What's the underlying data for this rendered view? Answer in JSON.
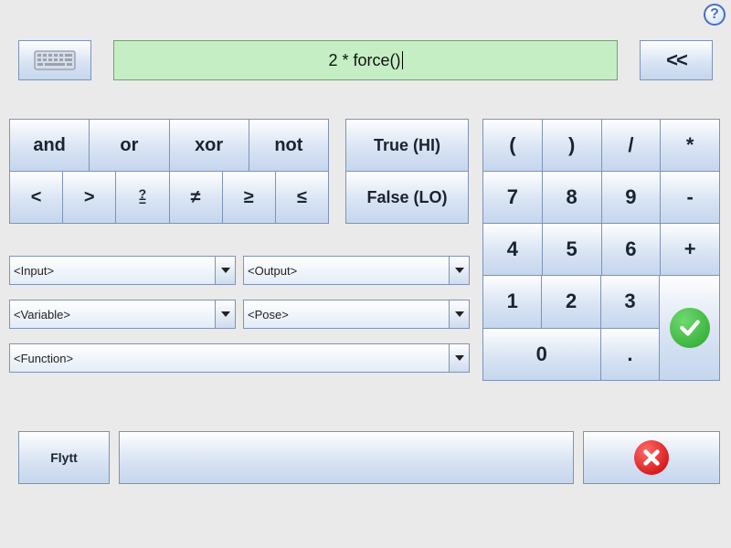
{
  "help_tooltip": "?",
  "expression": "2 * force()",
  "backspace_label": "<<",
  "logic": {
    "and": "and",
    "or": "or",
    "xor": "xor",
    "not": "not"
  },
  "compare": {
    "lt": "<",
    "gt": ">",
    "qe": "≟",
    "ne": "≠",
    "ge": "≥",
    "le": "≤"
  },
  "bool": {
    "true": "True (HI)",
    "false": "False (LO)"
  },
  "dropdowns": {
    "input": "<Input>",
    "output": "<Output>",
    "variable": "<Variable>",
    "pose": "<Pose>",
    "function": "<Function>"
  },
  "numpad": {
    "lparen": "(",
    "rparen": ")",
    "div": "/",
    "mul": "*",
    "7": "7",
    "8": "8",
    "9": "9",
    "minus": "-",
    "4": "4",
    "5": "5",
    "6": "6",
    "plus": "+",
    "1": "1",
    "2": "2",
    "3": "3",
    "0": "0",
    "dot": "."
  },
  "flytt_label": "Flytt"
}
